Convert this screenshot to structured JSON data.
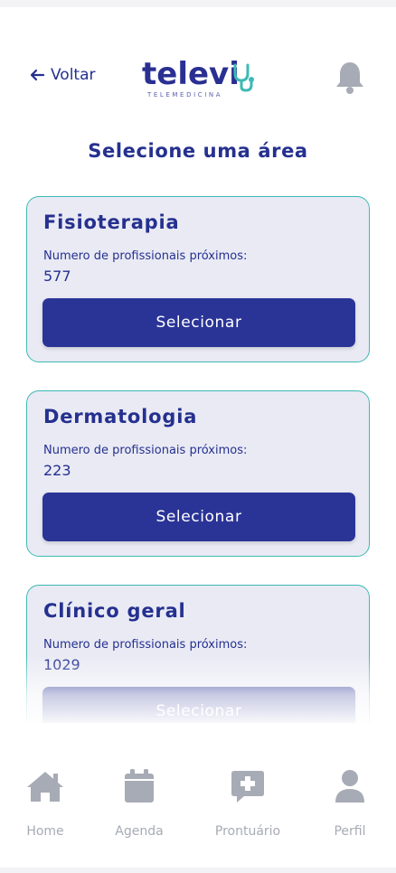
{
  "header": {
    "back_label": "Voltar",
    "logo_text": "televi",
    "logo_subtext": "TELEMEDICINA"
  },
  "page_title": "Selecione uma área",
  "areas": [
    {
      "name": "Fisioterapia",
      "count_label": "Numero de profissionais próximos:",
      "count": "577",
      "button": "Selecionar"
    },
    {
      "name": "Dermatologia",
      "count_label": "Numero de profissionais próximos:",
      "count": "223",
      "button": "Selecionar"
    },
    {
      "name": "Clínico geral",
      "count_label": "Numero de profissionais próximos:",
      "count": "1029",
      "button": "Selecionar"
    }
  ],
  "tabbar": {
    "items": [
      {
        "label": "Home",
        "icon": "home-icon"
      },
      {
        "label": "Agenda",
        "icon": "calendar-icon"
      },
      {
        "label": "Prontuário",
        "icon": "medical-chat-icon"
      },
      {
        "label": "Perfil",
        "icon": "user-icon"
      }
    ]
  },
  "colors": {
    "primary": "#2a3497",
    "card_bg": "#e9eaf4",
    "card_border": "#3cbab5",
    "accent_teal": "#3cbab5",
    "muted_icon": "#a7abb5"
  }
}
